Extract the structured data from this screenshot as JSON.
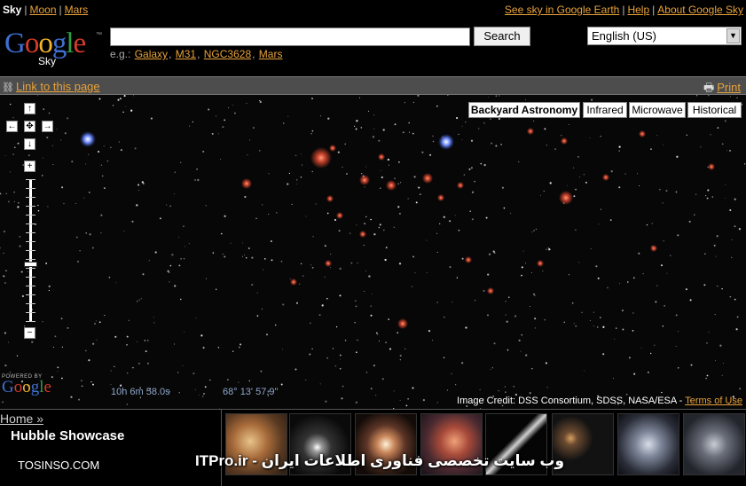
{
  "topnav": {
    "current": "Sky",
    "links": [
      "Moon",
      "Mars"
    ],
    "right_links": [
      "See sky in Google Earth",
      "Help",
      "About Google Sky"
    ]
  },
  "logo": {
    "brand": "Google",
    "product": "Sky",
    "tm": "™"
  },
  "search": {
    "value": "",
    "button_label": "Search"
  },
  "examples": {
    "prefix": "e.g.:",
    "items": [
      "Galaxy",
      "M31",
      "NGC3628",
      "Mars"
    ]
  },
  "language": {
    "selected": "English (US)"
  },
  "linkbar": {
    "link_label": "Link to this page",
    "print_label": "Print"
  },
  "map": {
    "layers": [
      "Backyard Astronomy",
      "Infrared",
      "Microwave",
      "Historical"
    ],
    "active_layer": "Backyard Astronomy",
    "powered_by": "POWERED BY",
    "powered_brand": "Google",
    "ra": "10h 6m 58.0s",
    "dec": "68° 13' 57.9\"",
    "credit": "Image Credit: DSS Consortium, SDSS, NASA/ESA -",
    "terms_label": "Terms of Use",
    "nav_icons": [
      "arrow-up-icon",
      "arrow-left-icon",
      "center-icon",
      "arrow-right-icon",
      "arrow-down-icon",
      "zoom-in-icon",
      "zoom-out-icon"
    ],
    "zoom_level": 0.6
  },
  "bottom": {
    "home_label": "Home »",
    "showcase_title": "Hubble Showcase",
    "site_label": "TOSINSO.COM",
    "watermark": "ITPro.ir - وب سایت تخصصی فناوری اطلاعات ایران",
    "thumbnails": [
      "nebula",
      "galaxy-pair",
      "spiral-galaxy",
      "star-cluster",
      "edge-on-galaxy",
      "galaxy-cluster",
      "globular-cluster",
      "star-field"
    ]
  },
  "colors": {
    "link": "#e8a23a",
    "coords": "#8fa8cc",
    "background": "#000000"
  }
}
